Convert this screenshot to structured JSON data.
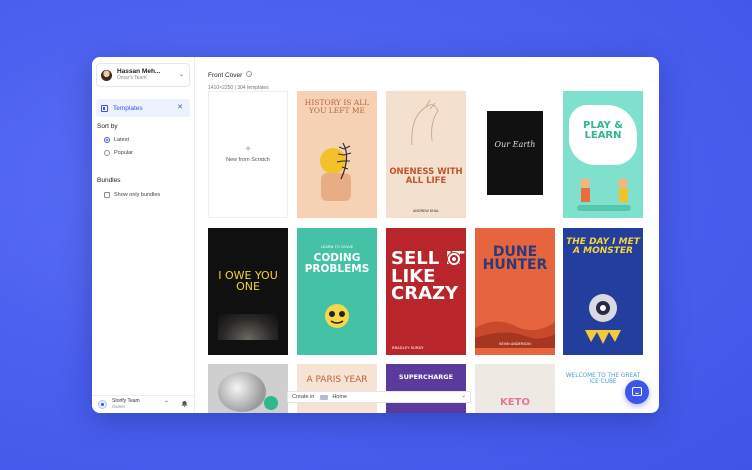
{
  "account": {
    "name": "Hassan Meh...",
    "team": "Omar's Team"
  },
  "nav": {
    "templates_label": "Templates"
  },
  "sort": {
    "title": "Sort by",
    "options": [
      "Latest",
      "Popular"
    ],
    "selected": "Latest"
  },
  "bundles": {
    "title": "Bundles",
    "checkbox_label": "Show only bundles",
    "checked": false
  },
  "footer": {
    "org_name": "Storify Team",
    "org_role": "Owner"
  },
  "header": {
    "title": "Front Cover",
    "subtitle": "1410×2250 | 304 templates"
  },
  "scratch": {
    "plus": "+",
    "label": "New from Scratch"
  },
  "covers": [
    {
      "title": "HISTORY IS ALL YOU LEFT ME",
      "sub": "",
      "bg": "#f6d2b5"
    },
    {
      "title": "ONENESS WITH ALL LIFE",
      "sub": "ANDREW KHAL",
      "bg": "#f3e0cf"
    },
    {
      "title": "Our Earth",
      "sub": "",
      "bg": "#ffffff"
    },
    {
      "title": "PLAY & LEARN",
      "sub": "",
      "bg": "#7ee0cd"
    },
    {
      "title": "I OWE YOU ONE",
      "sub": "",
      "bg": "#101010"
    },
    {
      "title": "CODING PROBLEMS",
      "sub": "LEARN TO SOLVE",
      "bg": "#45c2a6"
    },
    {
      "title": "SELL IT LIKE CRAZY",
      "sub": "BRADLEY SURDY",
      "bg": "#b8262b"
    },
    {
      "title": "DUNE HUNTER",
      "sub": "KEVIN ANDERSON",
      "bg": "#e6653e"
    },
    {
      "title": "THE DAY I MET A MONSTER",
      "sub": "",
      "bg": "#233e9c"
    },
    {
      "title": "",
      "sub": "",
      "bg": "#cfcfcf"
    },
    {
      "title": "A PARIS YEAR",
      "sub": "",
      "bg": "#f6e3d3"
    },
    {
      "title": "SUPERCHARGE",
      "sub": "",
      "bg": "#5a3a9a"
    },
    {
      "title": "KETO",
      "sub": "",
      "bg": "#efe9e4"
    },
    {
      "title": "WELCOME TO THE GREAT ICE CUBE",
      "sub": "",
      "bg": "#ffffff"
    }
  ],
  "create_bar": {
    "label": "Create in",
    "location": "Home"
  },
  "colors": {
    "accent": "#3b55e6",
    "background": "#4c61ef"
  },
  "icons": {
    "account_chevron": "chevron-down-icon",
    "templates": "templates-icon",
    "close": "close-icon",
    "info": "info-icon",
    "chat": "chat-icon",
    "bell": "bell-icon"
  }
}
